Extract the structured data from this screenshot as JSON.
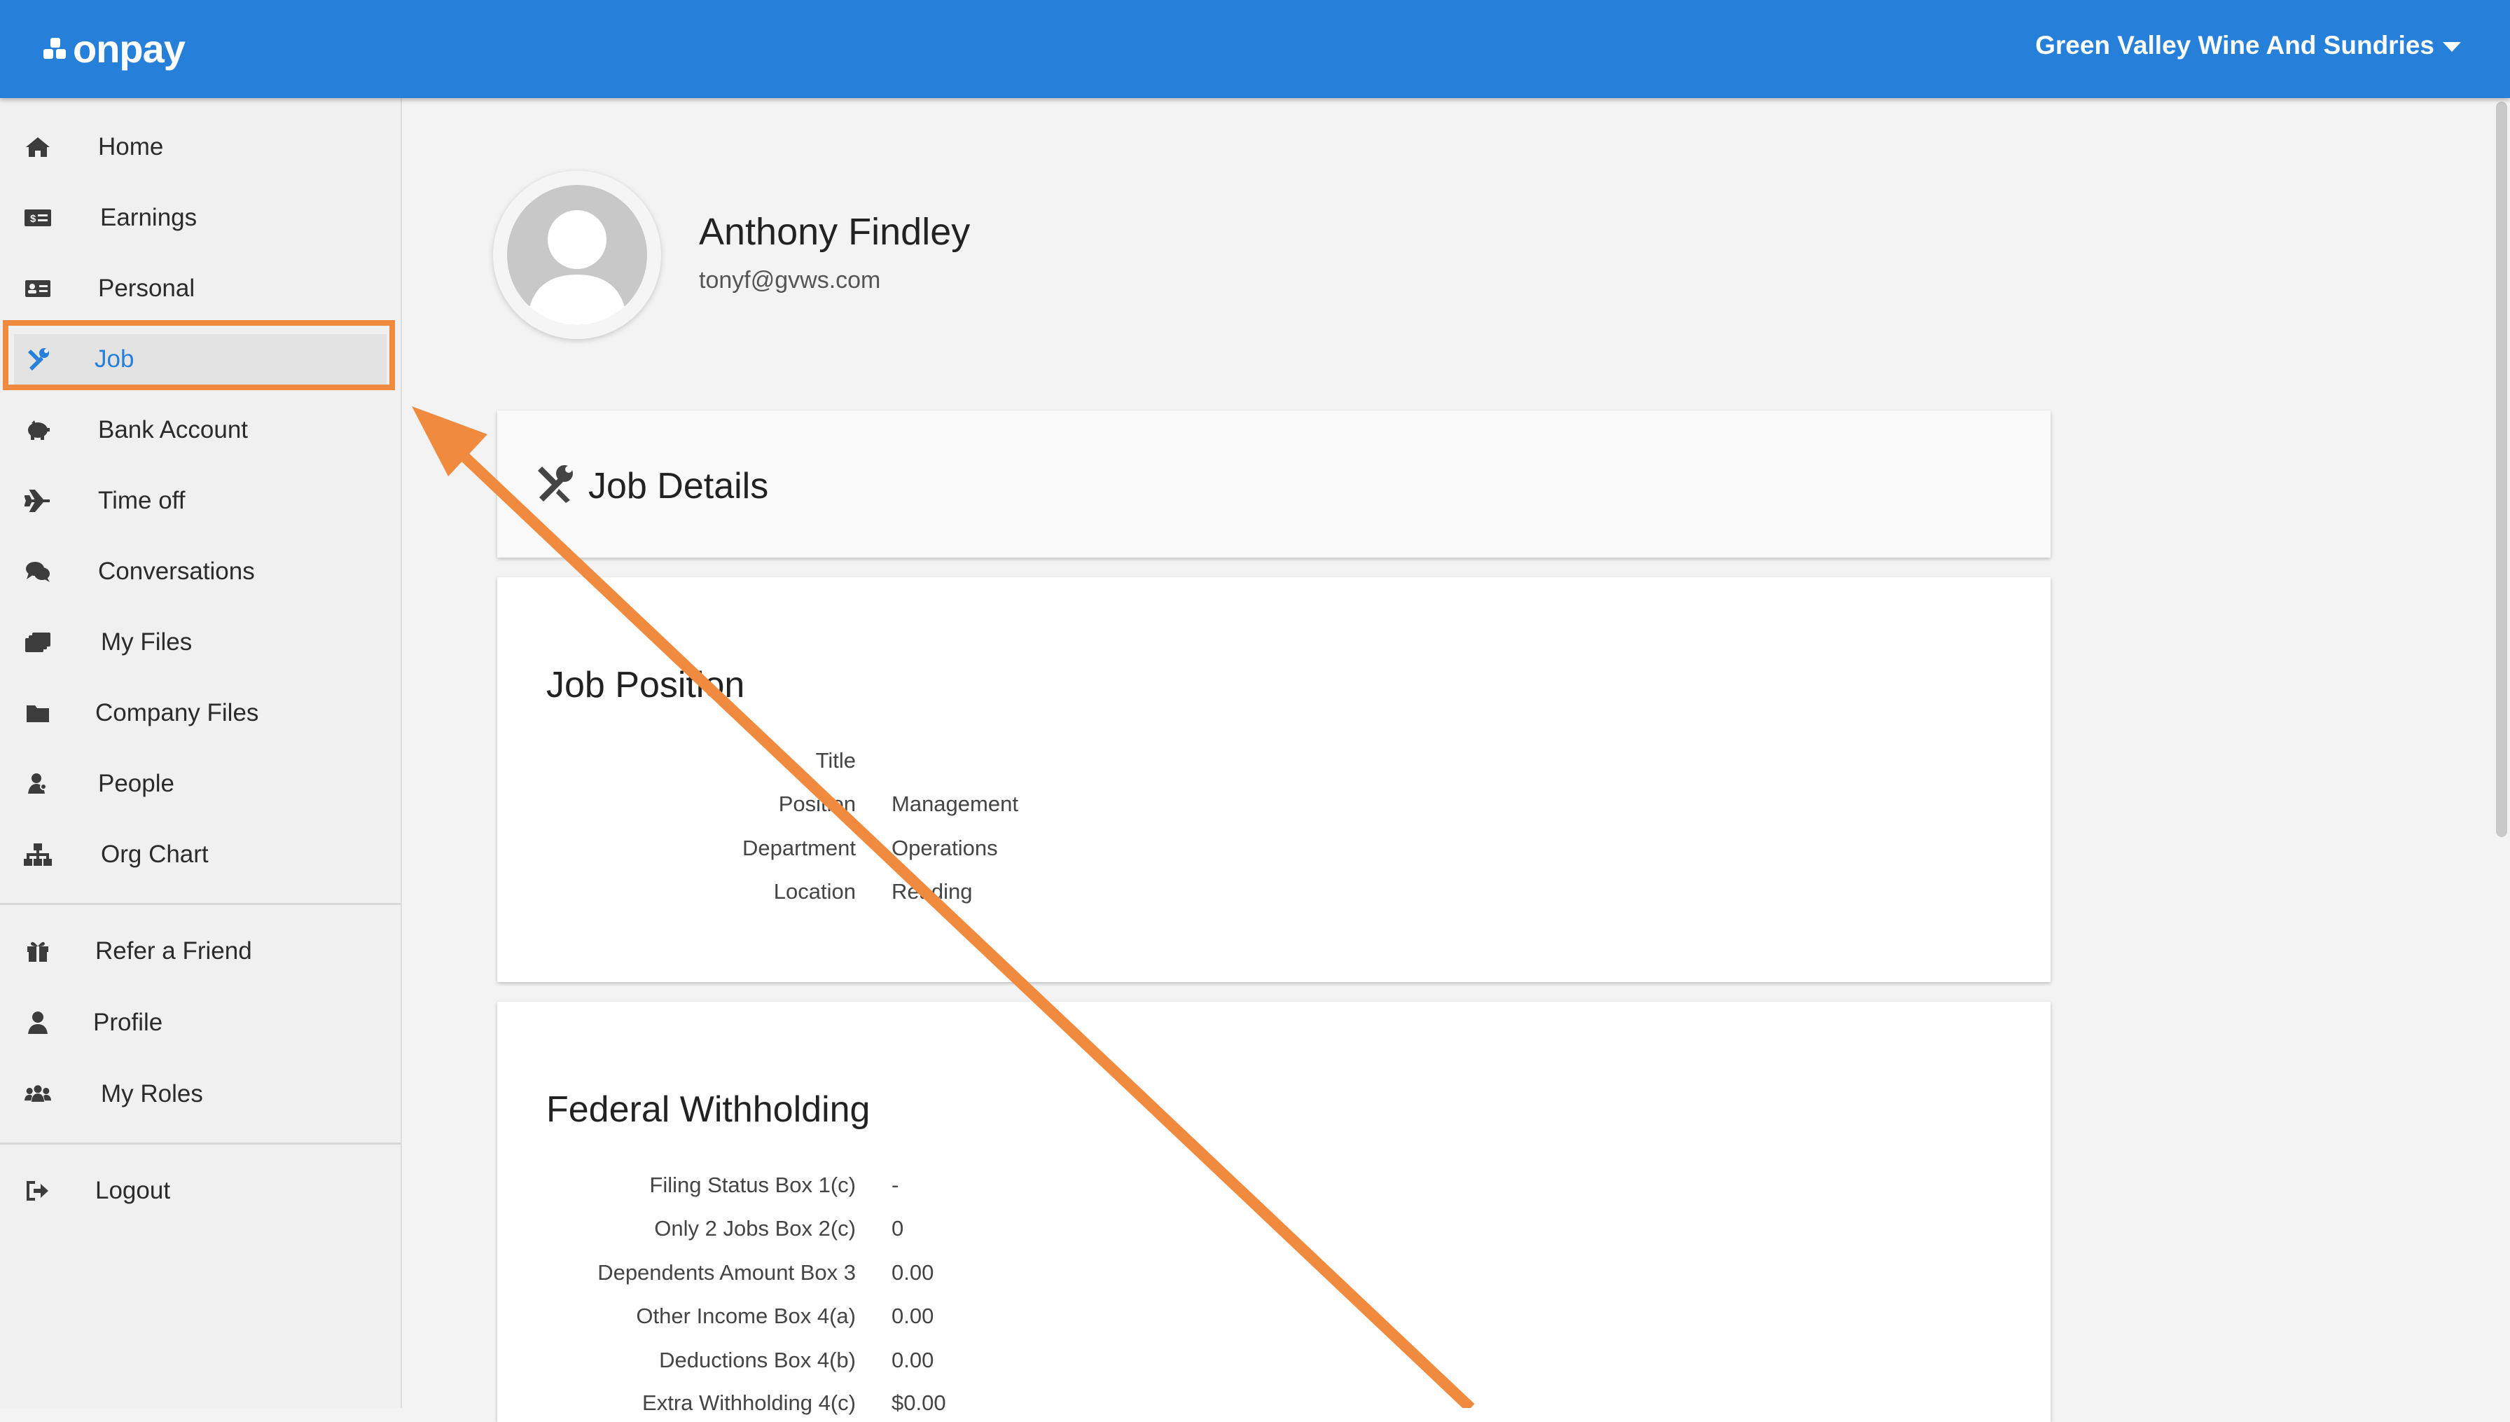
{
  "app": {
    "brand": "onpay",
    "company": "Green Valley Wine And Sundries",
    "accent_color": "#2680d9",
    "annotation_color": "#ef8a3e"
  },
  "sidebar": {
    "items": [
      {
        "label": "Home",
        "icon": "home-icon"
      },
      {
        "label": "Earnings",
        "icon": "money-icon"
      },
      {
        "label": "Personal",
        "icon": "id-card-icon"
      },
      {
        "label": "Job",
        "icon": "tools-icon",
        "active": true
      },
      {
        "label": "Bank Account",
        "icon": "piggy-bank-icon"
      },
      {
        "label": "Time off",
        "icon": "plane-icon"
      },
      {
        "label": "Conversations",
        "icon": "comments-icon"
      },
      {
        "label": "My Files",
        "icon": "files-icon"
      },
      {
        "label": "Company Files",
        "icon": "folder-icon"
      },
      {
        "label": "People",
        "icon": "people-icon"
      },
      {
        "label": "Org Chart",
        "icon": "org-chart-icon"
      },
      {
        "label": "Refer a Friend",
        "icon": "gift-icon"
      },
      {
        "label": "Profile",
        "icon": "user-icon"
      },
      {
        "label": "My Roles",
        "icon": "users-icon"
      },
      {
        "label": "Logout",
        "icon": "logout-icon"
      }
    ]
  },
  "employee": {
    "name": "Anthony Findley",
    "email": "tonyf@gvws.com"
  },
  "job_details": {
    "title": "Job Details"
  },
  "job_position": {
    "title": "Job Position",
    "rows": [
      {
        "label": "Title",
        "value": ""
      },
      {
        "label": "Position",
        "value": "Management"
      },
      {
        "label": "Department",
        "value": "Operations"
      },
      {
        "label": "Location",
        "value": "Reading"
      }
    ]
  },
  "federal_withholding": {
    "title": "Federal Withholding",
    "rows": [
      {
        "label": "Filing Status Box 1(c)",
        "value": "-"
      },
      {
        "label": "Only 2 Jobs Box 2(c)",
        "value": "0"
      },
      {
        "label": "Dependents Amount Box 3",
        "value": "0.00"
      },
      {
        "label": "Other Income Box 4(a)",
        "value": "0.00"
      },
      {
        "label": "Deductions Box 4(b)",
        "value": "0.00"
      },
      {
        "label": "Extra Withholding 4(c)",
        "value": "$0.00"
      }
    ]
  }
}
